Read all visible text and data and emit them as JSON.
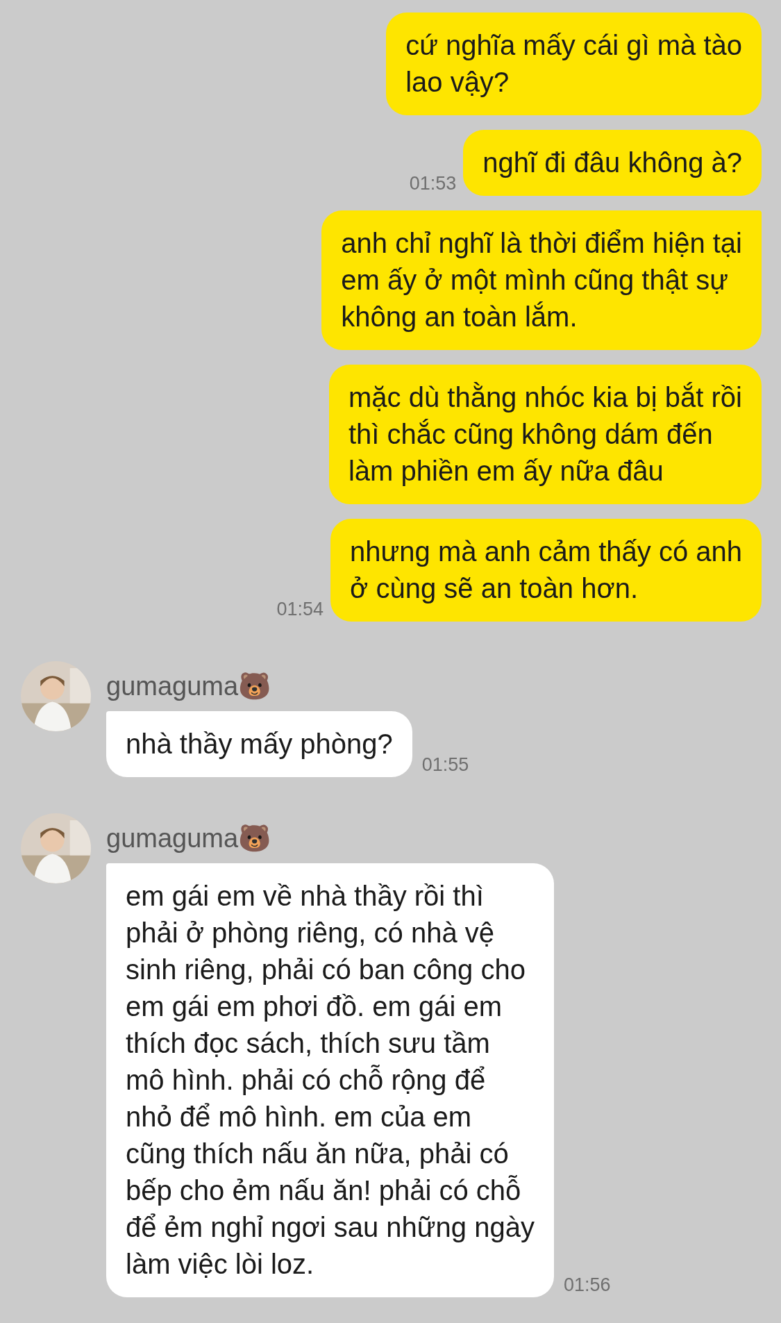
{
  "messages": [
    {
      "kind": "outgoing",
      "tail": false,
      "lines": [
        "cứ nghĩa mấy cái gì mà tào",
        "lao vậy?"
      ]
    },
    {
      "kind": "outgoing",
      "tail": false,
      "lines": [
        "nghĩ đi đâu không à?"
      ],
      "time": "01:53"
    },
    {
      "kind": "outgoing",
      "tail": true,
      "lines": [
        "anh chỉ nghĩ là thời điểm hiện tại",
        "em ấy ở một mình cũng thật sự",
        "không an toàn lắm."
      ]
    },
    {
      "kind": "outgoing",
      "tail": false,
      "lines": [
        "mặc dù thằng nhóc kia bị bắt rồi",
        "thì chắc cũng không dám đến",
        "làm phiền em ấy nữa đâu"
      ]
    },
    {
      "kind": "outgoing",
      "tail": false,
      "lines": [
        "nhưng mà anh cảm thấy có anh",
        "ở cùng sẽ an toàn hơn."
      ],
      "time": "01:54"
    },
    {
      "kind": "incoming",
      "tail": true,
      "sender": "gumaguma🐻",
      "lines": [
        "nhà thầy mấy phòng?"
      ],
      "time": "01:55"
    },
    {
      "kind": "incoming",
      "tail": true,
      "sender": "gumaguma🐻",
      "lines": [
        "em gái em về nhà thầy rồi thì",
        "phải ở phòng riêng, có nhà vệ",
        "sinh riêng, phải có ban công cho",
        "em gái em phơi đồ. em gái em",
        "thích đọc sách, thích sưu tầm",
        "mô hình. phải có chỗ rộng để",
        "nhỏ để mô hình. em của em",
        "cũng thích nấu ăn nữa, phải có",
        "bếp cho ẻm nấu ăn! phải có chỗ",
        "để ẻm nghỉ ngơi sau những ngày",
        "làm việc lòi loz."
      ],
      "time": "01:56"
    }
  ]
}
